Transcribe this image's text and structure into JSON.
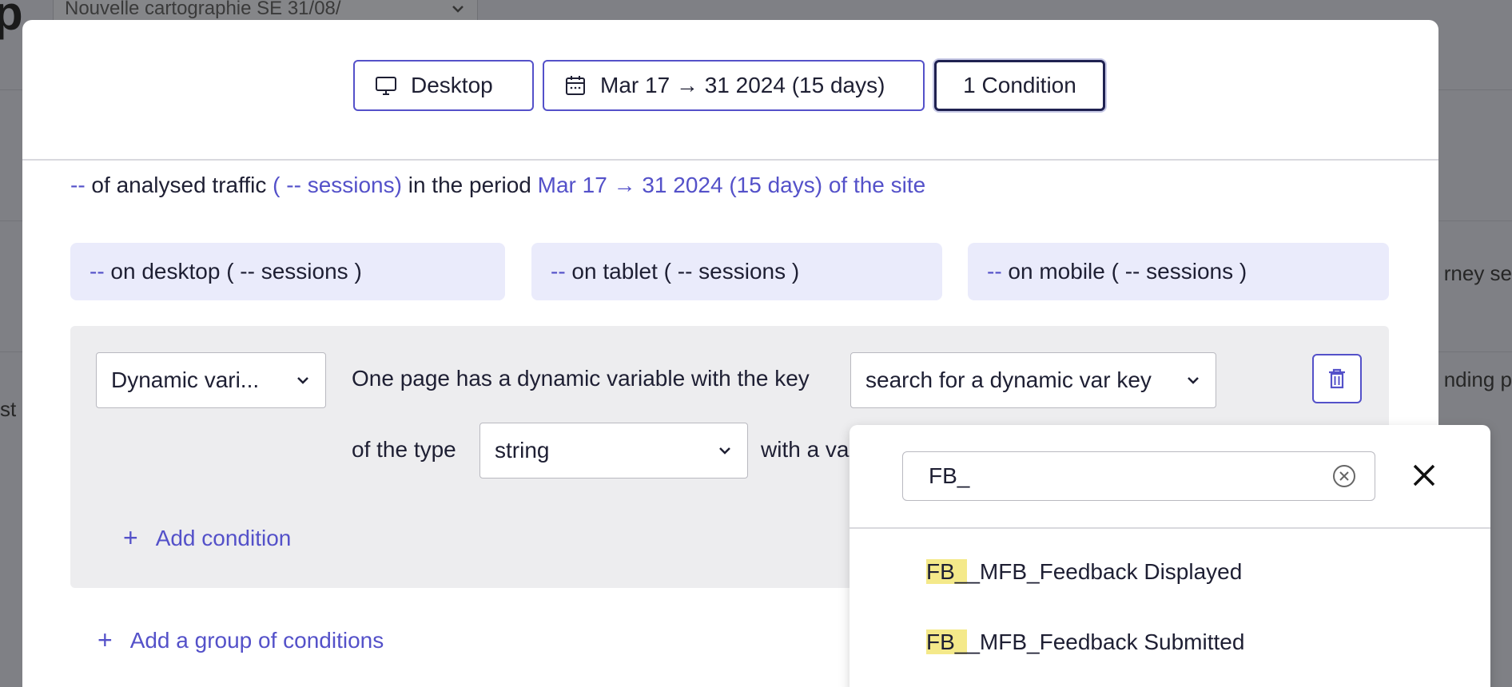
{
  "background": {
    "title_fragment": "p",
    "select_label": "Nouvelle cartographie SE 31/08/",
    "right_text_1": "rney se",
    "right_text_2": "nding p",
    "left_text": "st"
  },
  "toolbar": {
    "device_label": "Desktop",
    "date_label": "Mar 17 → 31 2024 (15 days)",
    "conditions_label": "1 Condition"
  },
  "summary": {
    "traffic_value": "--",
    "traffic_text": " of analysed traffic ",
    "sessions_text": "( -- sessions)",
    "period_text": " in the period ",
    "period_value": "Mar 17 → 31 2024 (15 days) of the site"
  },
  "devices": [
    {
      "value": "--",
      "label": " on desktop ( -- sessions )"
    },
    {
      "value": "--",
      "label": " on tablet ( -- sessions )"
    },
    {
      "value": "--",
      "label": " on mobile ( -- sessions )"
    }
  ],
  "condition": {
    "type_select": "Dynamic vari...",
    "text_key": "One page has a dynamic variable with the key",
    "key_select": "search for a dynamic var key",
    "text_type": "of the type",
    "type_value": "string",
    "text_value": "with a va",
    "add_condition": "Add condition"
  },
  "add_group": "Add a group of conditions",
  "dropdown": {
    "search_value": "FB_",
    "items": [
      {
        "match": "FB_",
        "rest": "_MFB_Feedback Displayed"
      },
      {
        "match": "FB_",
        "rest": "_MFB_Feedback Submitted"
      }
    ]
  },
  "colors": {
    "accent": "#5451c9",
    "device_bg": "#eaebfb",
    "panel_bg": "#ededef",
    "highlight": "#f4e98a"
  }
}
